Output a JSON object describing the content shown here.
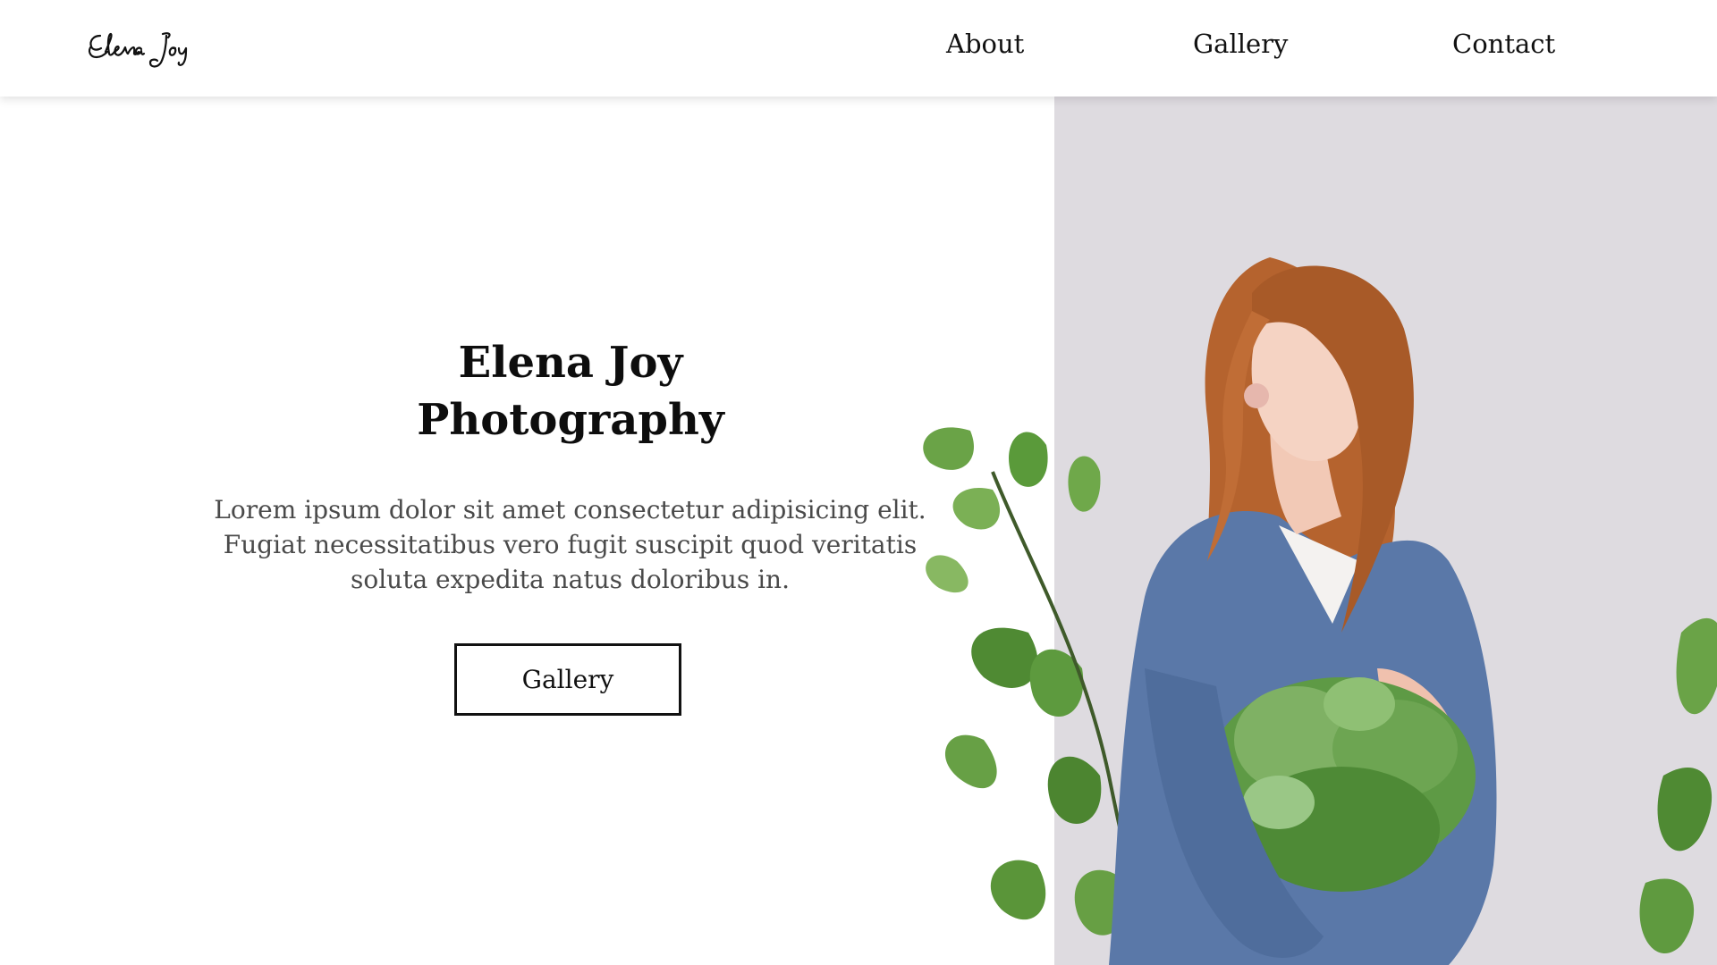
{
  "header": {
    "logo_text": "Elena Joy",
    "nav": {
      "about": "About",
      "gallery": "Gallery",
      "contact": "Contact"
    }
  },
  "hero": {
    "title_line1": "Elena Joy",
    "title_line2": "Photography",
    "description": "Lorem ipsum dolor sit amet consectetur adipisicing elit. Fugiat necessitatibus vero fugit suscipit quod veritatis soluta expedita natus doloribus in.",
    "button_label": "Gallery"
  },
  "photo": {
    "subject": "woman-holding-flowers-photo",
    "background_color": "#dedbe0",
    "sweater_color": "#5a78a8",
    "hair_color": "#b5632e",
    "plant_color": "#5a8f3a"
  }
}
